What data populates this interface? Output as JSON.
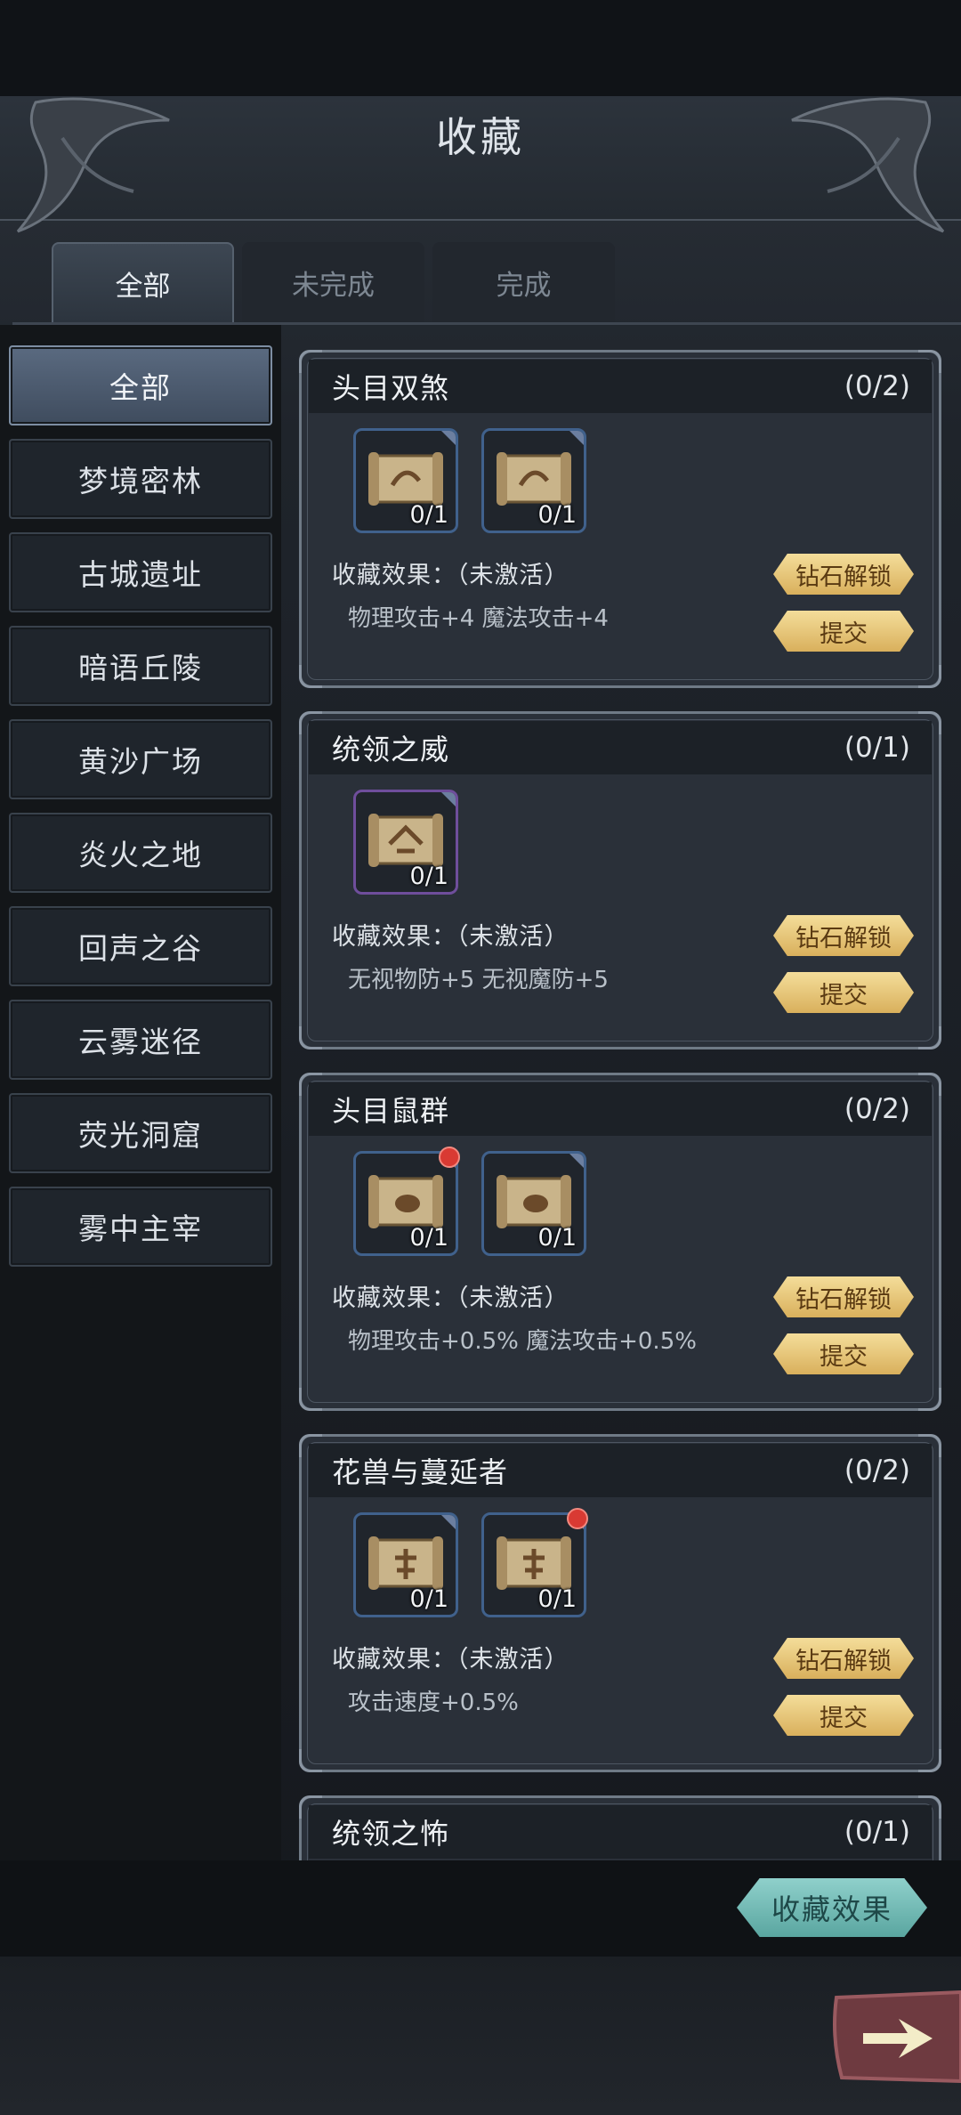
{
  "title": "收藏",
  "tabs": [
    {
      "label": "全部",
      "active": true
    },
    {
      "label": "未完成",
      "active": false
    },
    {
      "label": "完成",
      "active": false
    }
  ],
  "sidebar": [
    {
      "label": "全部",
      "active": true
    },
    {
      "label": "梦境密林"
    },
    {
      "label": "古城遗址"
    },
    {
      "label": "暗语丘陵"
    },
    {
      "label": "黄沙广场"
    },
    {
      "label": "炎火之地"
    },
    {
      "label": "回声之谷"
    },
    {
      "label": "云雾迷径"
    },
    {
      "label": "荧光洞窟"
    },
    {
      "label": "雾中主宰"
    }
  ],
  "cards": [
    {
      "title": "头目双煞",
      "count": "(0/2)",
      "items": [
        {
          "count": "0/1",
          "rarity": "blue",
          "icon": "scroll-icon",
          "dot": false
        },
        {
          "count": "0/1",
          "rarity": "blue",
          "icon": "scroll-icon",
          "dot": false
        }
      ],
      "effect": "收藏效果：（未激活）",
      "stats": "物理攻击+4  魔法攻击+4",
      "unlock": "钻石解锁",
      "submit": "提交"
    },
    {
      "title": "统领之威",
      "count": "(0/1)",
      "items": [
        {
          "count": "0/1",
          "rarity": "purple",
          "icon": "scroll-icon",
          "dot": false
        }
      ],
      "effect": "收藏效果：（未激活）",
      "stats": "无视物防+5  无视魔防+5",
      "unlock": "钻石解锁",
      "submit": "提交"
    },
    {
      "title": "头目鼠群",
      "count": "(0/2)",
      "items": [
        {
          "count": "0/1",
          "rarity": "blue",
          "icon": "scroll-icon",
          "dot": true
        },
        {
          "count": "0/1",
          "rarity": "blue",
          "icon": "scroll-icon",
          "dot": false
        }
      ],
      "effect": "收藏效果：（未激活）",
      "stats": "物理攻击+0.5%  魔法攻击+0.5%",
      "unlock": "钻石解锁",
      "submit": "提交"
    },
    {
      "title": "花兽与蔓延者",
      "count": "(0/2)",
      "items": [
        {
          "count": "0/1",
          "rarity": "blue",
          "icon": "scroll-icon",
          "dot": false
        },
        {
          "count": "0/1",
          "rarity": "blue",
          "icon": "scroll-icon",
          "dot": true
        }
      ],
      "effect": "收藏效果：（未激活）",
      "stats": "攻击速度+0.5%",
      "unlock": "钻石解锁",
      "submit": "提交"
    },
    {
      "title": "统领之怖",
      "count": "(0/1)"
    }
  ],
  "bottom": {
    "effect_button": "收藏效果",
    "next_icon": "arrow-right-icon"
  },
  "colors": {
    "accent_gold": "#e8c77a",
    "accent_teal": "#7bc2bd",
    "notify_red": "#d93a33"
  }
}
